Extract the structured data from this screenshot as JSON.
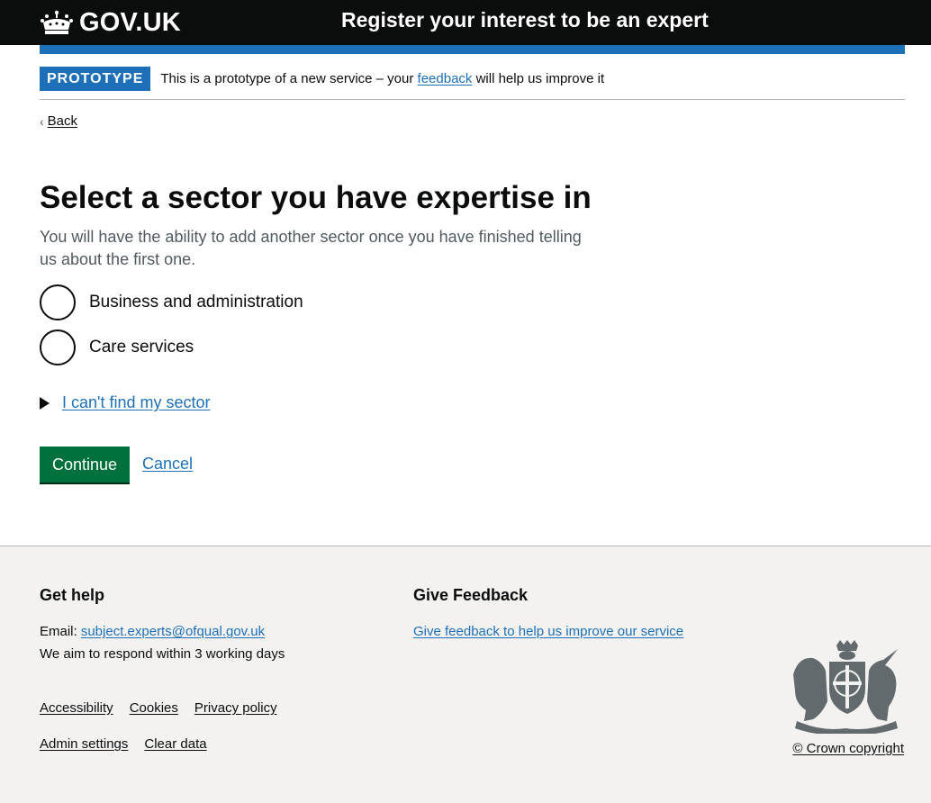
{
  "header": {
    "logo_text": "GOV.UK",
    "service_name": "Register your interest to be an expert"
  },
  "phase_banner": {
    "tag": "PROTOTYPE",
    "text_before": "This is a prototype of a new service – your ",
    "link": "feedback",
    "text_after": " will help us improve it"
  },
  "back_link": "Back",
  "main": {
    "title": "Select a sector you have expertise in",
    "hint": "You will have the ability to add another sector once you have finished telling us about the first one.",
    "options": [
      {
        "label": "Business and administration"
      },
      {
        "label": "Care services"
      }
    ],
    "details_summary": "I can't find my sector",
    "continue_label": "Continue",
    "cancel_label": "Cancel"
  },
  "footer": {
    "help_heading": "Get help",
    "email_label": "Email: ",
    "email": "subject.experts@ofqual.gov.uk",
    "response": "We aim to respond within 3 working days",
    "feedback_heading": "Give Feedback",
    "feedback_link": "Give feedback to help us improve our service",
    "links_row1": [
      "Accessibility",
      "Cookies",
      "Privacy policy"
    ],
    "links_row2": [
      "Admin settings",
      "Clear data"
    ],
    "copyright": "© Crown copyright"
  },
  "colors": {
    "header_bg": "#0b0c0c",
    "brand_blue": "#1d70b8",
    "button_green": "#00703c",
    "footer_bg": "#f3f2f1"
  }
}
